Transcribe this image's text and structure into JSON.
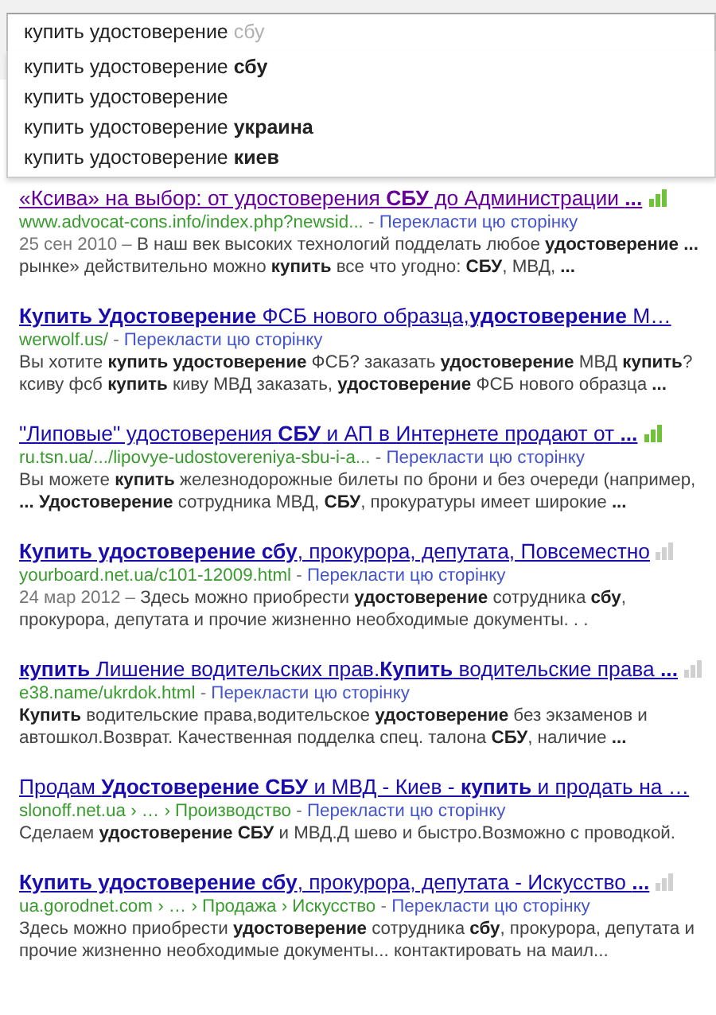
{
  "search": {
    "value": "купить удостоверение",
    "completion": "сбу"
  },
  "suggestions": [
    "купить удостоверение **сбу**",
    "купить удостоверение",
    "купить удостоверение **украина**",
    "купить удостоверение **киев**"
  ],
  "results": [
    {
      "title": "«Ксива» на выбор: от удостоверения **СБУ** до Администрации **...**",
      "visited": true,
      "color": "#6fc23a",
      "url": "www.advocat-cons.info/index.php?newsid...",
      "separator": "-",
      "translate": "Перекласти цю сторінку",
      "date": "25 сен 2010 –",
      "snippet": "В наш век высоких технологий подделать любое **удостоверение ...** рынке» действительно можно **купить** все что угодно: **СБУ**, МВД, **...**"
    },
    {
      "title": "**Купить Удостоверение** ФСБ нового образца,**удостоверение** М…",
      "visited": false,
      "url": "werwolf.us/",
      "separator": "-",
      "translate": "Перекласти цю сторінку",
      "snippet": "Вы хотите **купить удостоверение** ФСБ? заказать **удостоверение** МВД **купить**? ксиву фсб **купить** киву МВД заказать, **удостоверение** ФСБ нового образца **...**"
    },
    {
      "title": "\"Липовые\" удостоверения **СБУ** и АП в Интернете продают от **...**",
      "visited": false,
      "color": "#6fc23a",
      "url": "ru.tsn.ua/.../lipovye-udostovereniya-sbu-i-a...",
      "separator": "-",
      "translate": "Перекласти цю сторінку",
      "snippet": "Вы можете **купить** железнодорожные билеты по брони и без очереди (например, **...** **Удостоверение** сотрудника МВД, **СБУ**, прокуратуры имеет широкие **...**"
    },
    {
      "title": "**Купить удостоверение сбу**, прокурора, депутата, Повсеместно",
      "visited": false,
      "color": "#d0d0d0",
      "url": "yourboard.net.ua/c101-12009.html",
      "separator": "-",
      "translate": "Перекласти цю сторінку",
      "date": "24 мар 2012 –",
      "snippet": "Здесь можно приобрести **удостоверение** сотрудника **сбу**, прокурора, депутата и прочие жизненно необходимые документы. . ."
    },
    {
      "title": "**купить** Лишение водительских прав.**Купить** водительские права **...**",
      "visited": false,
      "color": "#d0d0d0",
      "url": "e38.name/ukrdok.html",
      "separator": "-",
      "translate": "Перекласти цю сторінку",
      "snippet": "**Купить** водительские права,водительское **удостоверение** без экзаменов и автошкол.Возврат. Качественная подделка спец. талона **СБУ**, наличие **...**"
    },
    {
      "title": "Продам **Удостоверение СБУ** и МВД - Киев - **купить** и продать на …",
      "visited": false,
      "url": "slonoff.net.ua › … › Производство",
      "separator": "-",
      "translate": "Перекласти цю сторінку",
      "snippet": "Сделаем **удостоверение СБУ** и МВД.Д шево и быстро.Возможно с проводкой."
    },
    {
      "title": "**Купить удостоверение сбу**, прокурора, депутата - Искусство **...**",
      "visited": false,
      "color": "#d0d0d0",
      "url": "ua.gorodnet.com › … › Продажа › Искусство",
      "separator": "-",
      "translate": "Перекласти цю сторінку",
      "snippet": "Здесь можно приобрести **удостоверение** сотрудника **сбу**, прокурора, депутата и прочие жизненно необходимые документы... контактировать на маил..."
    }
  ]
}
